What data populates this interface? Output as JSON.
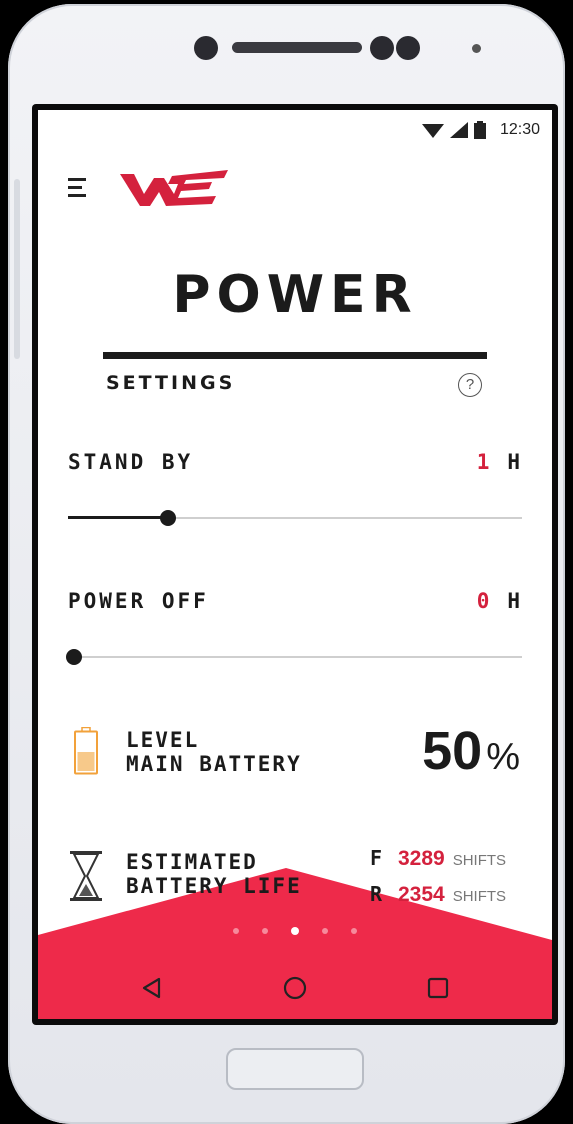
{
  "status_bar": {
    "time": "12:30"
  },
  "header": {
    "logo_text": "WE"
  },
  "page": {
    "title": "POWER",
    "section": "SETTINGS",
    "help_symbol": "?"
  },
  "standby": {
    "label": "STAND BY",
    "value": "1",
    "unit": "H",
    "slider_fraction": 0.22
  },
  "poweroff": {
    "label": "POWER OFF",
    "value": "0",
    "unit": "H",
    "slider_fraction": 0.0
  },
  "battery": {
    "line1": "LEVEL",
    "line2": "MAIN BATTERY",
    "value": "50",
    "unit": "%"
  },
  "estimate": {
    "line1": "ESTIMATED",
    "line2": "BATTERY LIFE",
    "front": {
      "key": "F",
      "value": "3289",
      "unit": "SHIFTS"
    },
    "rear": {
      "key": "R",
      "value": "2354",
      "unit": "SHIFTS"
    }
  },
  "pager": {
    "count": 5,
    "active_index": 2
  },
  "colors": {
    "accent": "#d4213d",
    "panel": "#ee2a4a",
    "battery": "#f2a13a",
    "text": "#1b1b1b"
  },
  "icons": {
    "menu": "hamburger-icon",
    "help": "help-circle-icon",
    "battery": "battery-icon",
    "estimate": "hourglass-icon",
    "wifi": "wifi-icon",
    "signal": "signal-icon",
    "battery_status": "battery-status-icon",
    "back": "back-triangle-icon",
    "home": "home-circle-icon",
    "recents": "recents-square-icon"
  }
}
